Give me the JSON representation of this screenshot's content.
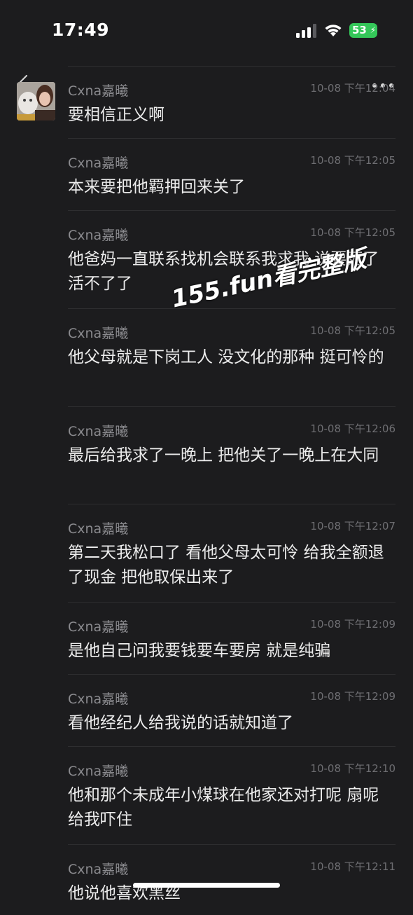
{
  "status_bar": {
    "time": "17:49",
    "battery": "53"
  },
  "conversation": {
    "messages": [
      {
        "sender": "Cxna嘉曦",
        "time": "10-08 下午12:04",
        "text": "要相信正义啊"
      },
      {
        "sender": "Cxna嘉曦",
        "time": "10-08 下午12:05",
        "text": "本来要把他羁押回来关了"
      },
      {
        "sender": "Cxna嘉曦",
        "time": "10-08 下午12:05",
        "text": "他爸妈一直联系找机会联系我求我 说要死了 活不了了"
      },
      {
        "sender": "Cxna嘉曦",
        "time": "10-08 下午12:05",
        "text": "他父母就是下岗工人 没文化的那种 挺可怜的"
      },
      {
        "sender": "Cxna嘉曦",
        "time": "10-08 下午12:06",
        "text": "最后给我求了一晚上  把他关了一晚上在大同"
      },
      {
        "sender": "Cxna嘉曦",
        "time": "10-08 下午12:07",
        "text": "第二天我松口了 看他父母太可怜 给我全额退了现金 把他取保出来了"
      },
      {
        "sender": "Cxna嘉曦",
        "time": "10-08 下午12:09",
        "text": "是他自己问我要钱要车要房 就是纯骗"
      },
      {
        "sender": "Cxna嘉曦",
        "time": "10-08 下午12:09",
        "text": "看他经纪人给我说的话就知道了"
      },
      {
        "sender": "Cxna嘉曦",
        "time": "10-08 下午12:10",
        "text": "他和那个未成年小煤球在他家还对打呢 扇呢 给我吓住"
      },
      {
        "sender": "Cxna嘉曦",
        "time": "10-08 下午12:11",
        "text": "他说他喜欢黑丝"
      }
    ]
  },
  "watermark": "155.fun看完整版",
  "icons": {
    "back": "chevron-left-icon",
    "more": "more-dots-icon",
    "signal": "cellular-signal-icon",
    "wifi": "wifi-icon",
    "battery": "battery-icon"
  },
  "colors": {
    "background": "#1c1c1e",
    "sender": "#8a8a8e",
    "timestamp": "#6e6e72",
    "text": "#ececec",
    "battery": "#34c759"
  }
}
